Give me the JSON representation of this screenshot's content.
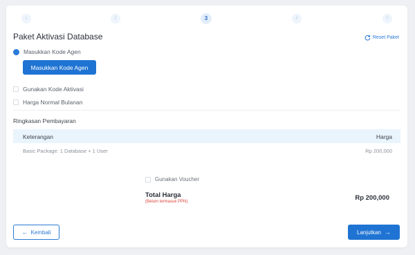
{
  "stepper": {
    "steps": [
      "1",
      "2",
      "3",
      "4",
      "5"
    ],
    "active_index": 3
  },
  "header": {
    "title": "Paket Aktivasi Database",
    "reset_label": "Reset Paket",
    "reset_icon": "refresh-icon"
  },
  "options": {
    "agent_code_label": "Masukkan Kode Agen",
    "agent_code_button": "Masukkan Kode Agen",
    "activation_code_label": "Gunakan Kode Aktivasi",
    "monthly_price_label": "Harga Normal Bulanan"
  },
  "summary": {
    "title": "Ringkasan Pembayaran",
    "columns": [
      "Keterangan",
      "Harga"
    ],
    "rows": [
      {
        "description": "Basic Package: 1 Database + 1 User",
        "price": "Rp 200,000"
      }
    ],
    "voucher_label": "Gunakan Voucher",
    "total_label": "Total Harga",
    "total_note": "(Belum termasuk PPN)",
    "total_value": "Rp 200,000"
  },
  "footer": {
    "back_label": "Kembali",
    "next_label": "Lanjutkan",
    "back_icon": "arrow-left-icon",
    "next_icon": "arrow-right-icon"
  },
  "colors": {
    "primary": "#1f74d3",
    "accent_text": "#2a78d6",
    "warning": "#d9443c",
    "table_header_bg": "#eaf4fd"
  }
}
